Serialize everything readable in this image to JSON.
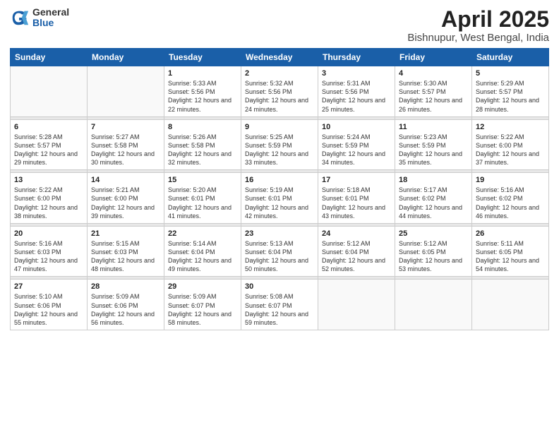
{
  "header": {
    "logo_general": "General",
    "logo_blue": "Blue",
    "title": "April 2025",
    "subtitle": "Bishnupur, West Bengal, India"
  },
  "weekdays": [
    "Sunday",
    "Monday",
    "Tuesday",
    "Wednesday",
    "Thursday",
    "Friday",
    "Saturday"
  ],
  "weeks": [
    [
      {
        "num": "",
        "empty": true
      },
      {
        "num": "",
        "empty": true
      },
      {
        "num": "1",
        "sunrise": "5:33 AM",
        "sunset": "5:56 PM",
        "daylight": "12 hours and 22 minutes."
      },
      {
        "num": "2",
        "sunrise": "5:32 AM",
        "sunset": "5:56 PM",
        "daylight": "12 hours and 24 minutes."
      },
      {
        "num": "3",
        "sunrise": "5:31 AM",
        "sunset": "5:56 PM",
        "daylight": "12 hours and 25 minutes."
      },
      {
        "num": "4",
        "sunrise": "5:30 AM",
        "sunset": "5:57 PM",
        "daylight": "12 hours and 26 minutes."
      },
      {
        "num": "5",
        "sunrise": "5:29 AM",
        "sunset": "5:57 PM",
        "daylight": "12 hours and 28 minutes."
      }
    ],
    [
      {
        "num": "6",
        "sunrise": "5:28 AM",
        "sunset": "5:57 PM",
        "daylight": "12 hours and 29 minutes."
      },
      {
        "num": "7",
        "sunrise": "5:27 AM",
        "sunset": "5:58 PM",
        "daylight": "12 hours and 30 minutes."
      },
      {
        "num": "8",
        "sunrise": "5:26 AM",
        "sunset": "5:58 PM",
        "daylight": "12 hours and 32 minutes."
      },
      {
        "num": "9",
        "sunrise": "5:25 AM",
        "sunset": "5:59 PM",
        "daylight": "12 hours and 33 minutes."
      },
      {
        "num": "10",
        "sunrise": "5:24 AM",
        "sunset": "5:59 PM",
        "daylight": "12 hours and 34 minutes."
      },
      {
        "num": "11",
        "sunrise": "5:23 AM",
        "sunset": "5:59 PM",
        "daylight": "12 hours and 35 minutes."
      },
      {
        "num": "12",
        "sunrise": "5:22 AM",
        "sunset": "6:00 PM",
        "daylight": "12 hours and 37 minutes."
      }
    ],
    [
      {
        "num": "13",
        "sunrise": "5:22 AM",
        "sunset": "6:00 PM",
        "daylight": "12 hours and 38 minutes."
      },
      {
        "num": "14",
        "sunrise": "5:21 AM",
        "sunset": "6:00 PM",
        "daylight": "12 hours and 39 minutes."
      },
      {
        "num": "15",
        "sunrise": "5:20 AM",
        "sunset": "6:01 PM",
        "daylight": "12 hours and 41 minutes."
      },
      {
        "num": "16",
        "sunrise": "5:19 AM",
        "sunset": "6:01 PM",
        "daylight": "12 hours and 42 minutes."
      },
      {
        "num": "17",
        "sunrise": "5:18 AM",
        "sunset": "6:01 PM",
        "daylight": "12 hours and 43 minutes."
      },
      {
        "num": "18",
        "sunrise": "5:17 AM",
        "sunset": "6:02 PM",
        "daylight": "12 hours and 44 minutes."
      },
      {
        "num": "19",
        "sunrise": "5:16 AM",
        "sunset": "6:02 PM",
        "daylight": "12 hours and 46 minutes."
      }
    ],
    [
      {
        "num": "20",
        "sunrise": "5:16 AM",
        "sunset": "6:03 PM",
        "daylight": "12 hours and 47 minutes."
      },
      {
        "num": "21",
        "sunrise": "5:15 AM",
        "sunset": "6:03 PM",
        "daylight": "12 hours and 48 minutes."
      },
      {
        "num": "22",
        "sunrise": "5:14 AM",
        "sunset": "6:04 PM",
        "daylight": "12 hours and 49 minutes."
      },
      {
        "num": "23",
        "sunrise": "5:13 AM",
        "sunset": "6:04 PM",
        "daylight": "12 hours and 50 minutes."
      },
      {
        "num": "24",
        "sunrise": "5:12 AM",
        "sunset": "6:04 PM",
        "daylight": "12 hours and 52 minutes."
      },
      {
        "num": "25",
        "sunrise": "5:12 AM",
        "sunset": "6:05 PM",
        "daylight": "12 hours and 53 minutes."
      },
      {
        "num": "26",
        "sunrise": "5:11 AM",
        "sunset": "6:05 PM",
        "daylight": "12 hours and 54 minutes."
      }
    ],
    [
      {
        "num": "27",
        "sunrise": "5:10 AM",
        "sunset": "6:06 PM",
        "daylight": "12 hours and 55 minutes."
      },
      {
        "num": "28",
        "sunrise": "5:09 AM",
        "sunset": "6:06 PM",
        "daylight": "12 hours and 56 minutes."
      },
      {
        "num": "29",
        "sunrise": "5:09 AM",
        "sunset": "6:07 PM",
        "daylight": "12 hours and 58 minutes."
      },
      {
        "num": "30",
        "sunrise": "5:08 AM",
        "sunset": "6:07 PM",
        "daylight": "12 hours and 59 minutes."
      },
      {
        "num": "",
        "empty": true
      },
      {
        "num": "",
        "empty": true
      },
      {
        "num": "",
        "empty": true
      }
    ]
  ]
}
